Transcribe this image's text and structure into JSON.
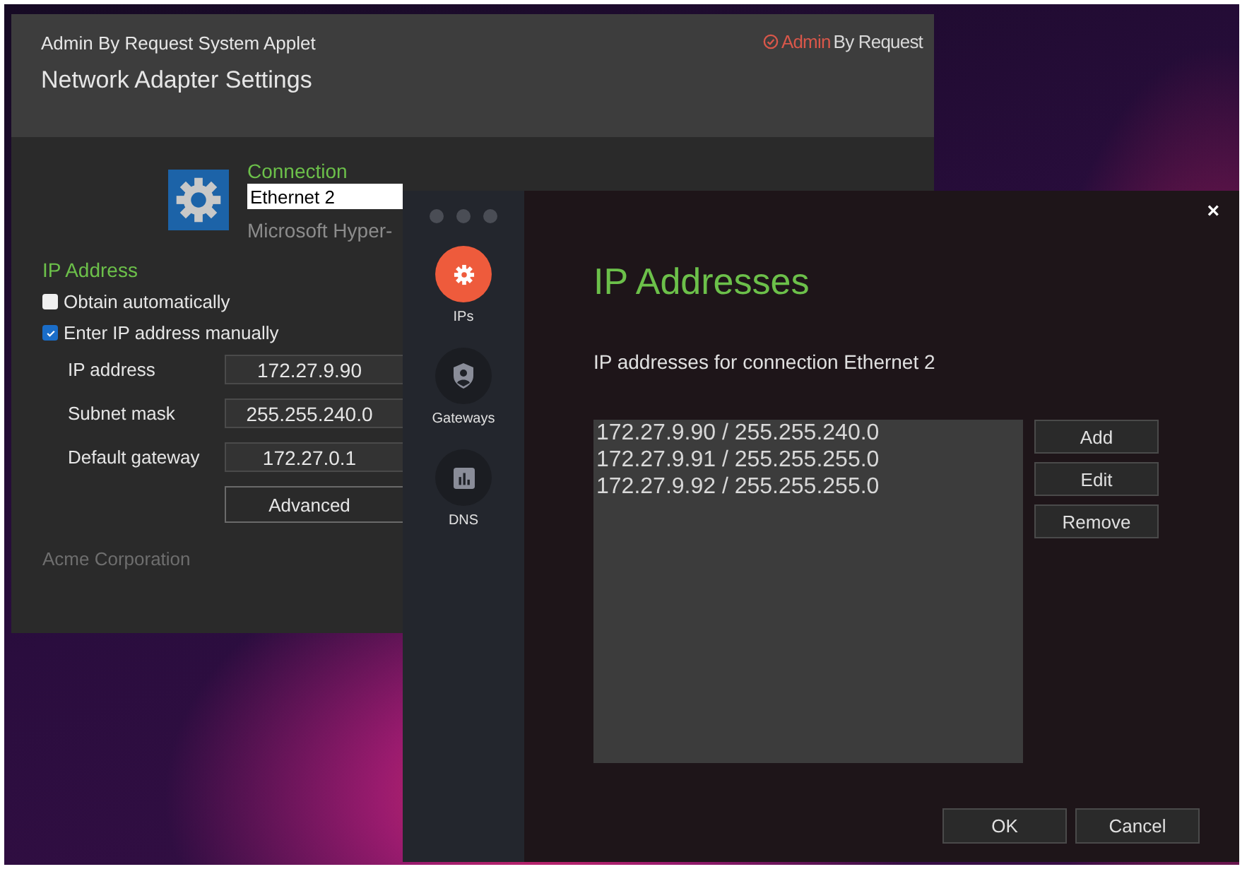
{
  "back_window": {
    "title": "Admin By Request System Applet",
    "heading": "Network Adapter Settings",
    "logo": {
      "prefix": "Admin",
      "suffix": "By Request"
    },
    "connection": {
      "label": "Connection",
      "value": "Ethernet 2",
      "adapter": "Microsoft Hyper-"
    },
    "ip_section": {
      "title": "IP Address",
      "options": [
        {
          "label": "Obtain automatically",
          "checked": false
        },
        {
          "label": "Enter IP address manually",
          "checked": true
        }
      ],
      "fields": [
        {
          "label": "IP address",
          "value": "172.27.9.90"
        },
        {
          "label": "Subnet mask",
          "value": "255.255.240.0"
        },
        {
          "label": "Default gateway",
          "value": "172.27.0.1"
        }
      ],
      "advanced_button": "Advanced"
    },
    "footer": "Acme Corporation"
  },
  "dialog": {
    "sidebar": [
      {
        "label": "IPs",
        "kind": "gear",
        "selected": true
      },
      {
        "label": "Gateways",
        "kind": "shield",
        "selected": false
      },
      {
        "label": "DNS",
        "kind": "chart",
        "selected": false
      }
    ],
    "close": "×",
    "title": "IP Addresses",
    "subtitle": "IP addresses for connection Ethernet 2",
    "addresses": [
      "172.27.9.90 / 255.255.240.0",
      "172.27.9.91 / 255.255.255.0",
      "172.27.9.92 / 255.255.255.0"
    ],
    "side_buttons": [
      "Add",
      "Edit",
      "Remove"
    ],
    "buttons": [
      "OK",
      "Cancel"
    ]
  }
}
